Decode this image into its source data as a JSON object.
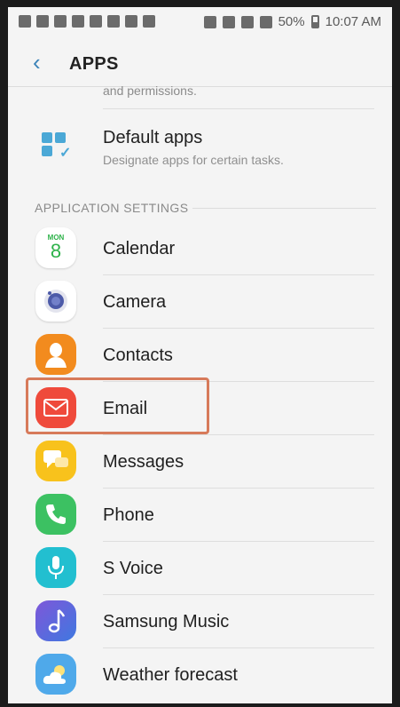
{
  "status_bar": {
    "battery": "50%",
    "time": "10:07 AM"
  },
  "header": {
    "back_icon": "back-chevron-icon",
    "title": "APPS"
  },
  "partial_text": "and permissions.",
  "default_apps": {
    "title": "Default apps",
    "subtitle": "Designate apps for certain tasks."
  },
  "section": {
    "title": "APPLICATION SETTINGS"
  },
  "calendar_icon": {
    "month": "MON",
    "day": "8"
  },
  "apps": [
    {
      "label": "Calendar"
    },
    {
      "label": "Camera"
    },
    {
      "label": "Contacts"
    },
    {
      "label": "Email"
    },
    {
      "label": "Messages"
    },
    {
      "label": "Phone"
    },
    {
      "label": "S Voice"
    },
    {
      "label": "Samsung Music"
    },
    {
      "label": "Weather forecast"
    }
  ],
  "colors": {
    "accent": "#3b83b8",
    "highlight": "#d77a5a"
  }
}
